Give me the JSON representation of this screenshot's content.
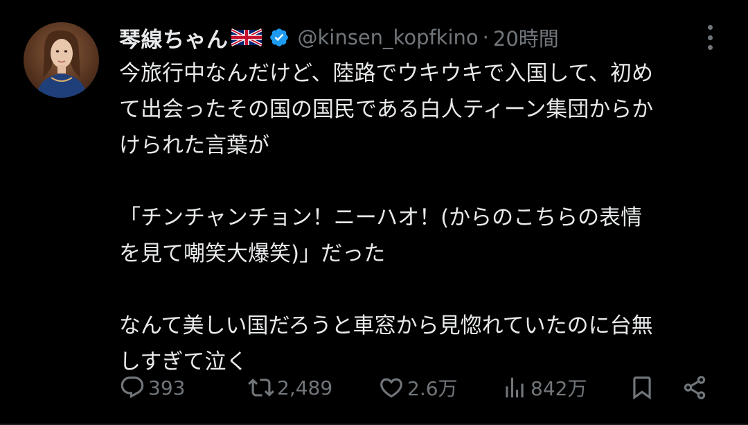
{
  "author": {
    "display_name": "琴線ちゃん",
    "handle": "@kinsen_kopfkino",
    "separator": "·",
    "time_ago": "20時間"
  },
  "tweet": {
    "paragraphs": [
      "今旅行中なんだけど、陸路でウキウキで入国して、初め\nて出会ったその国の国民である白人ティーン集団からか\nけられた言葉が",
      "「チンチャンチョン！ニーハオ！(からのこちらの表情\nを見て嘲笑大爆笑)」だった",
      "なんて美しい国だろうと車窓から見惚れていたのに台無\nしすぎて泣く"
    ]
  },
  "actions": {
    "replies": "393",
    "reposts": "2,489",
    "likes": "2.6万",
    "views": "842万"
  },
  "colors": {
    "background": "#000000",
    "text": "#e7e9ea",
    "muted": "#71767b",
    "verified": "#1d9bf0"
  }
}
